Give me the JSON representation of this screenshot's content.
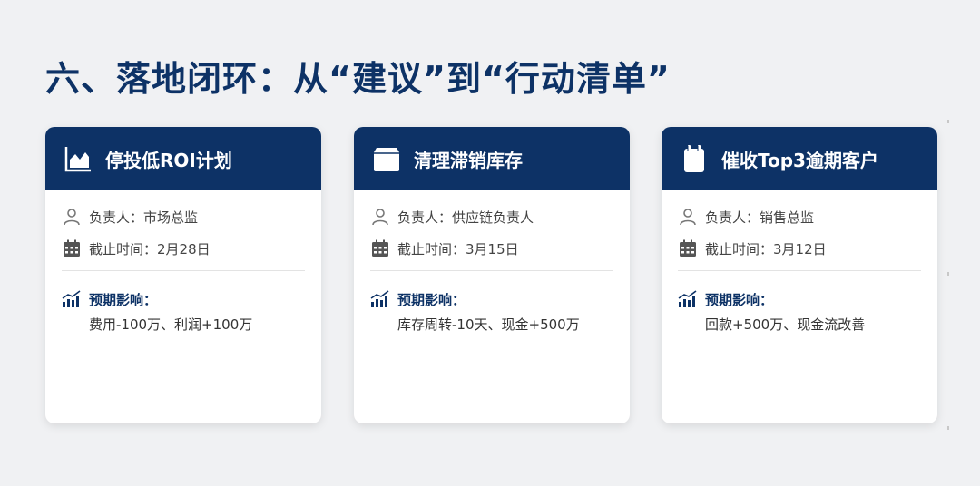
{
  "title": "六、落地闭环：从“建议”到“行动清单”",
  "colors": {
    "primary": "#0d3266",
    "background": "#f0f1f3",
    "card": "#ffffff"
  },
  "cards": [
    {
      "icon": "area-chart-icon",
      "title": "停投低ROI计划",
      "owner": "负责人：市场总监",
      "deadline": "截止时间：2月28日",
      "impact_label": "预期影响：",
      "impact_text": "费用-100万、利润+100万"
    },
    {
      "icon": "box-icon",
      "title": "清理滞销库存",
      "owner": "负责人：供应链负责人",
      "deadline": "截止时间：3月15日",
      "impact_label": "预期影响：",
      "impact_text": "库存周转-10天、现金+500万"
    },
    {
      "icon": "calendar-icon",
      "title": "催收Top3逾期客户",
      "owner": "负责人：销售总监",
      "deadline": "截止时间：3月12日",
      "impact_label": "预期影响：",
      "impact_text": "回款+500万、现金流改善"
    }
  ]
}
